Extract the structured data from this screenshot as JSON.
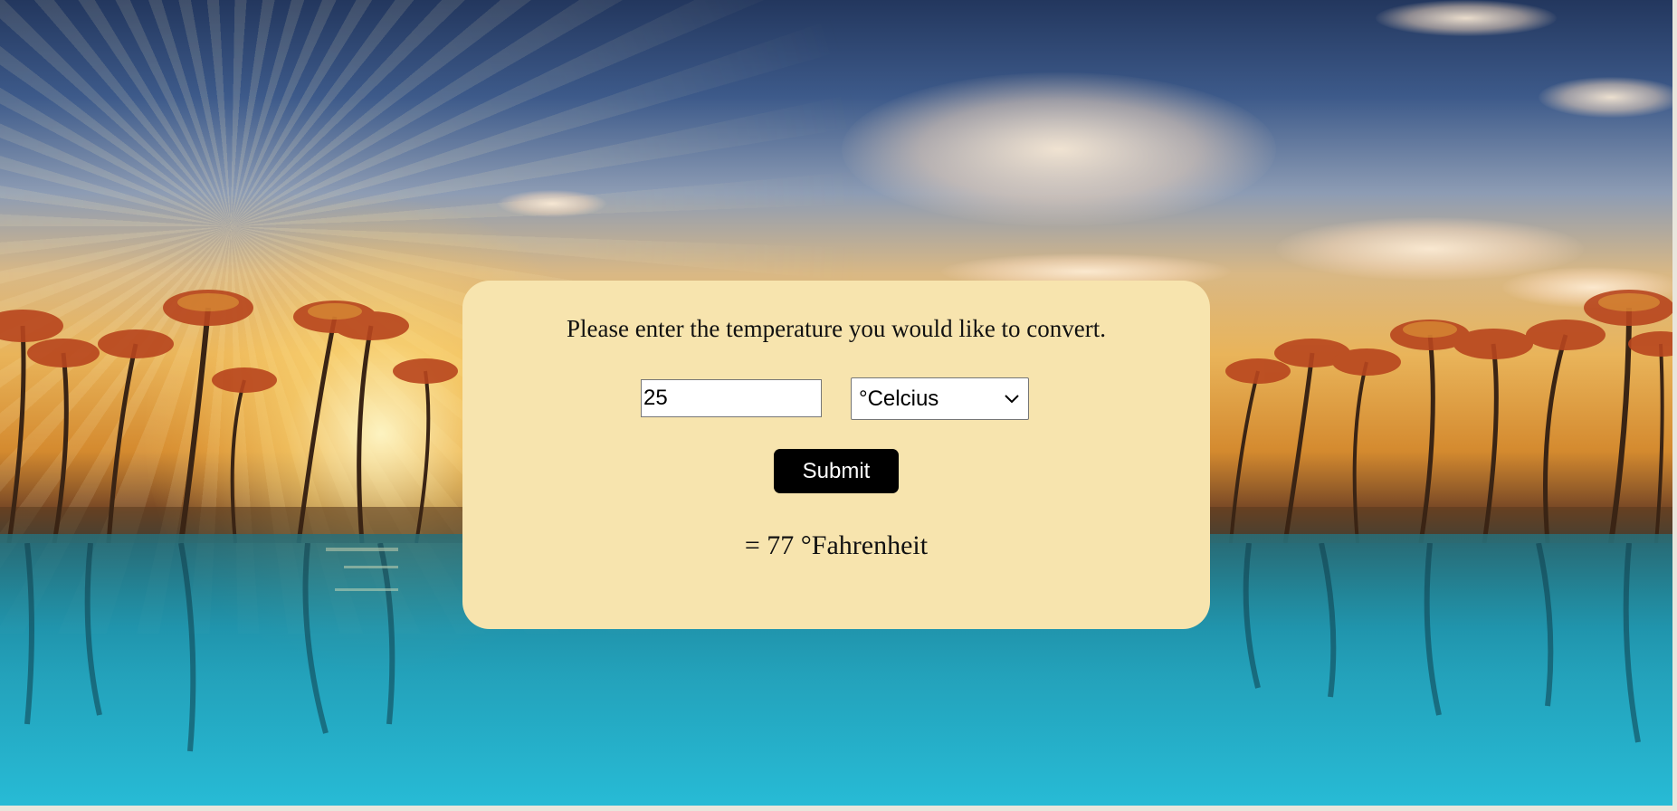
{
  "converter": {
    "prompt": "Please enter the temperature you would like to convert.",
    "temperature_value": "25",
    "unit_selected": "°Celcius",
    "submit_label": "Submit",
    "result": "= 77 °Fahrenheit"
  },
  "colors": {
    "card_background": "#f7e4ae",
    "button_background": "#000000",
    "button_text": "#ffffff"
  },
  "icons": {
    "select_arrow": "chevron-down-icon",
    "background": "tropical-sunset-photo"
  }
}
